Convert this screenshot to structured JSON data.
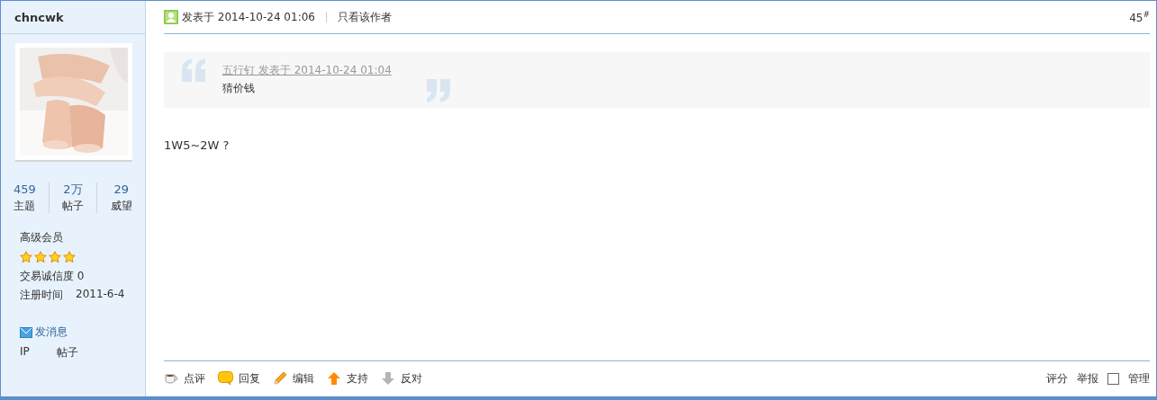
{
  "user": {
    "name": "chncwk",
    "avatar": {
      "kind": "picture"
    },
    "stats": [
      {
        "value": "459",
        "label": "主题"
      },
      {
        "value": "2万",
        "label": "帖子"
      },
      {
        "value": "29",
        "label": "威望"
      }
    ],
    "group": "高级会员",
    "stars": 4,
    "credit": "交易诚信度 0",
    "register_label": "注册时间",
    "register_date": "2011-6-4",
    "message_link": "发消息",
    "links": [
      "IP",
      "帖子"
    ]
  },
  "post": {
    "posted": "发表于 2014-10-24 01:06",
    "author_only": "只看该作者",
    "floor": "45$^{#}$",
    "quote": {
      "header": "五行钉 发表于 2014-10-24 01:04",
      "text": "猜价钱"
    },
    "body": "1W5~2W ?",
    "actions": [
      {
        "label": "点评",
        "kind": "comment"
      },
      {
        "label": "回复",
        "kind": "reply"
      },
      {
        "label": "编辑",
        "kind": "edit"
      },
      {
        "label": "支持",
        "kind": "support"
      },
      {
        "label": "反对",
        "kind": "oppose"
      }
    ],
    "right_actions": [
      "评分",
      "举报"
    ],
    "manage": {
      "label": "管理",
      "checked": false
    }
  }
}
